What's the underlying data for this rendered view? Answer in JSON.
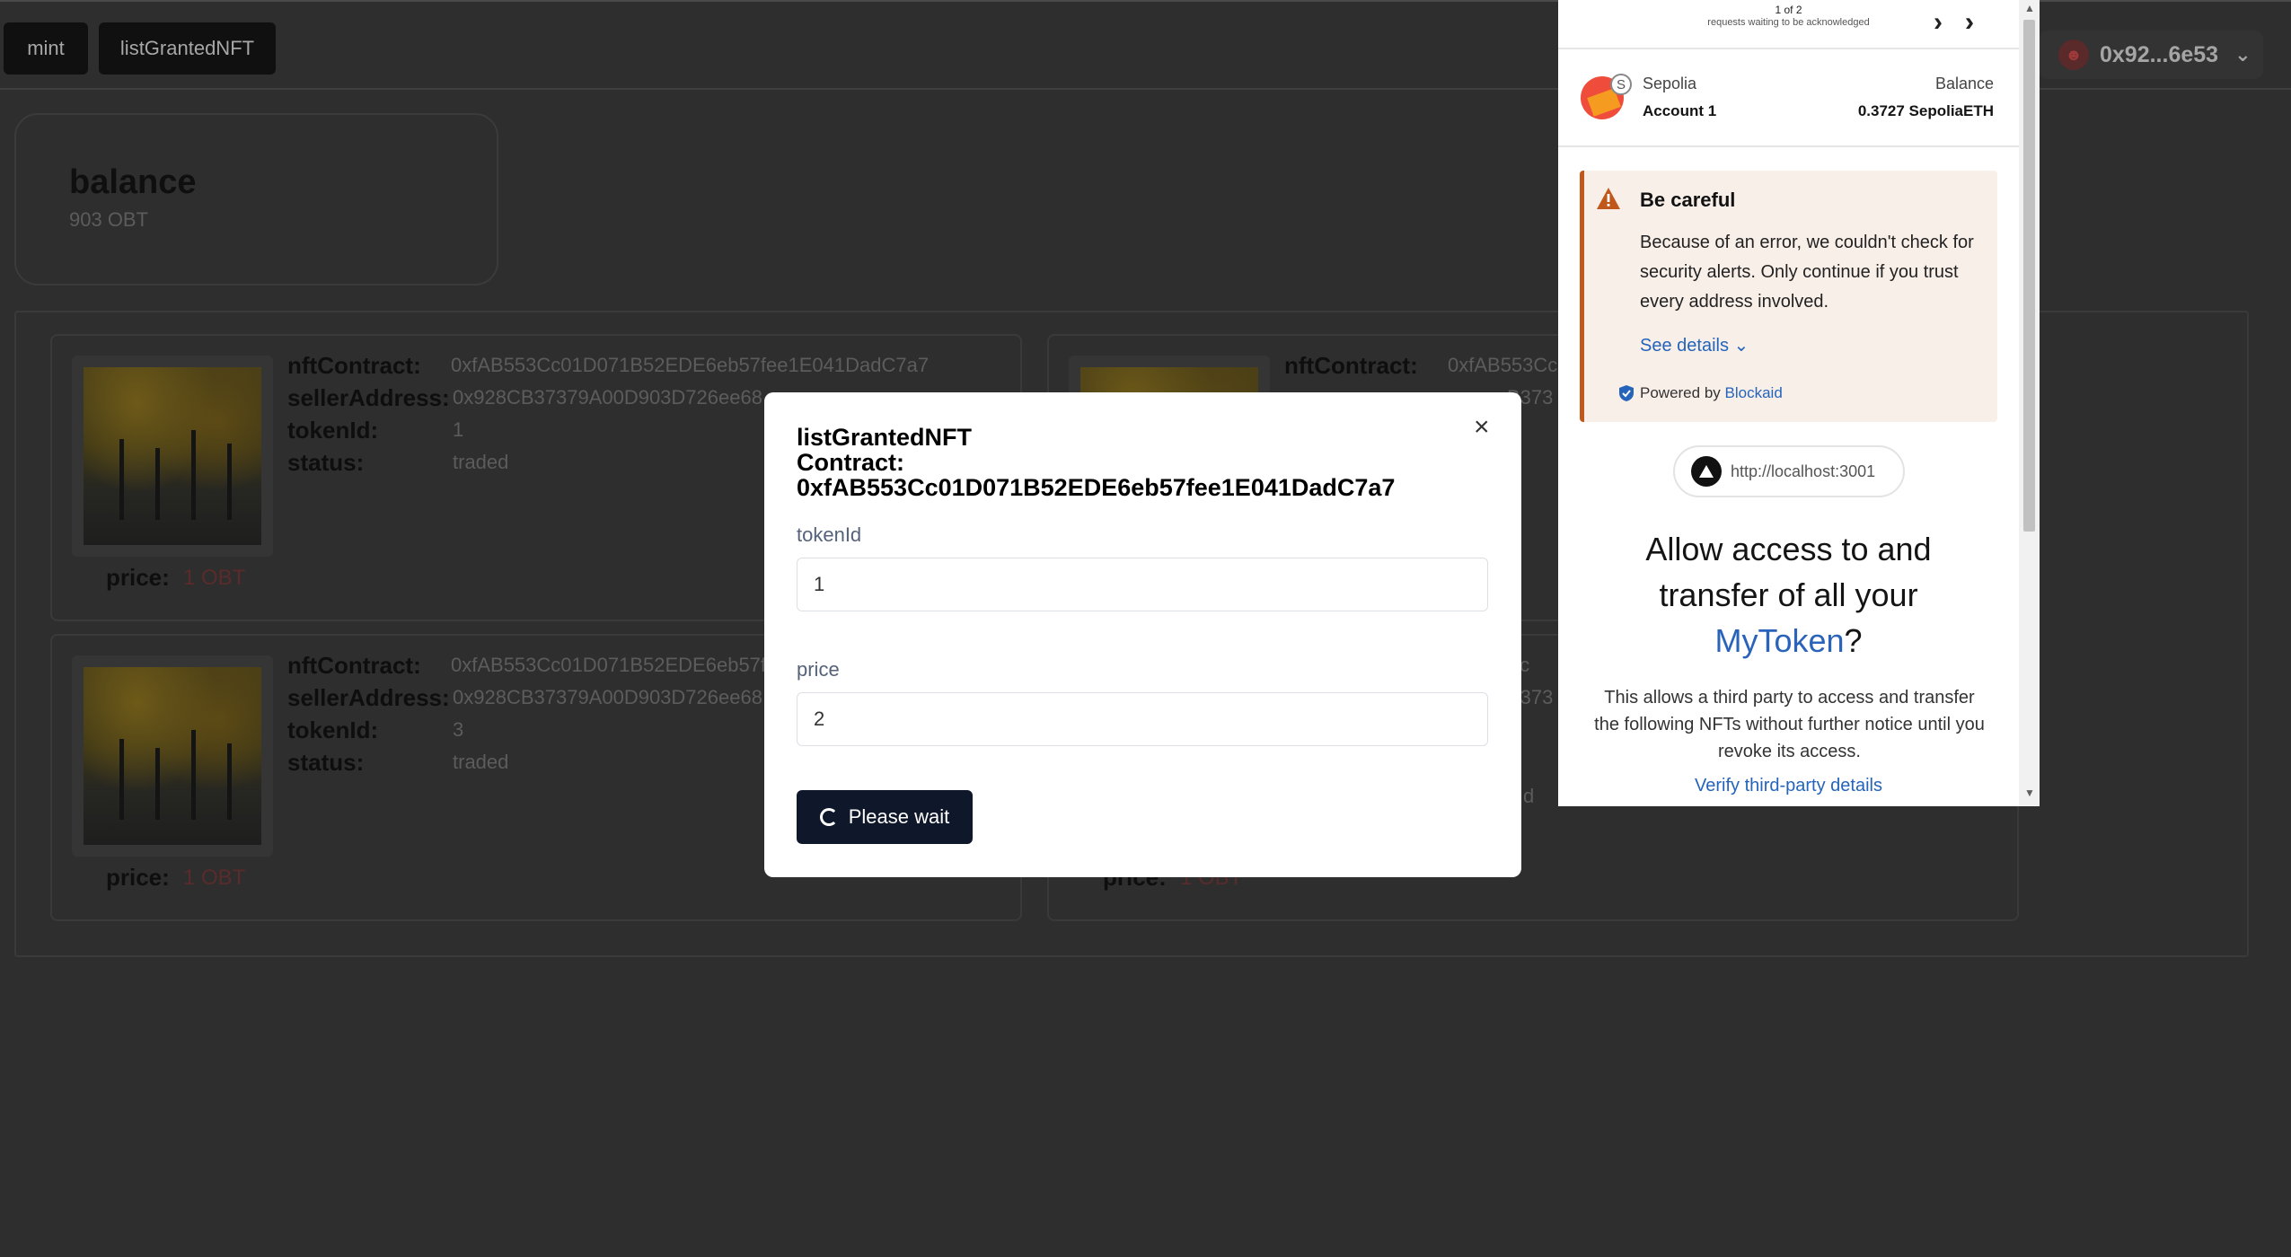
{
  "nav": {
    "mint_label": "mint",
    "list_label": "listGrantedNFT",
    "account_address": "0x92...6e53"
  },
  "balance": {
    "title": "balance",
    "value": "903 OBT"
  },
  "nft_labels": {
    "contract": "nftContract:",
    "seller": "sellerAddress:",
    "token": "tokenId:",
    "status": "status:",
    "price": "price:"
  },
  "nfts": [
    {
      "contract": "0xfAB553Cc01D071B52EDE6eb57fee1E041DadC7a7",
      "seller": "0x928CB37379A00D903D726ee68",
      "tokenId": "1",
      "status": "traded",
      "price": "1 OBT"
    },
    {
      "contract": "0xfAB553Cc",
      "seller": "B373",
      "tokenId": "",
      "status": "",
      "price": ""
    },
    {
      "contract": "0xfAB553Cc01D071B52EDE6eb57fe",
      "seller": "0x928CB37379A00D903D726ee68",
      "tokenId": "3",
      "status": "traded",
      "price": "1 OBT"
    },
    {
      "contract": "3Cc",
      "seller": "B373",
      "tokenId": "",
      "status": "d",
      "price": "1 OBT"
    }
  ],
  "modal": {
    "title_line1": "listGrantedNFT",
    "title_line2": "Contract:",
    "title_line3": "0xfAB553Cc01D071B52EDE6eb57fee1E041DadC7a7",
    "close_icon": "×",
    "token_label": "tokenId",
    "token_value": "1",
    "price_label": "price",
    "price_value": "2",
    "submit_label": "Please wait"
  },
  "wallet": {
    "pager": "1 of 2",
    "pager_sub": "requests waiting to be acknowledged",
    "next_icon": "›",
    "last_icon": "››",
    "network_badge": "S",
    "network": "Sepolia",
    "account": "Account 1",
    "balance_label": "Balance",
    "balance_value": "0.3727 SepoliaETH",
    "alert_title": "Be careful",
    "alert_body": "Because of an error, we couldn't check for security alerts. Only continue if you trust every address involved.",
    "see_details": "See details",
    "see_details_icon": "⌄",
    "powered_by": "Powered by",
    "powered_link": "Blockaid",
    "origin": "http://localhost:3001",
    "heading_line1": "Allow access to and",
    "heading_line2": "transfer of all your",
    "heading_token": "MyToken",
    "heading_end": "?",
    "description": "This allows a third party to access and transfer the following NFTs without further notice until you revoke its access.",
    "verify": "Verify third-party details"
  },
  "colors": {
    "overlay_bg": "#2e2e2e",
    "primary_button": "#0f172a",
    "link_blue": "#2464bb",
    "alert_accent": "#c0581c"
  }
}
